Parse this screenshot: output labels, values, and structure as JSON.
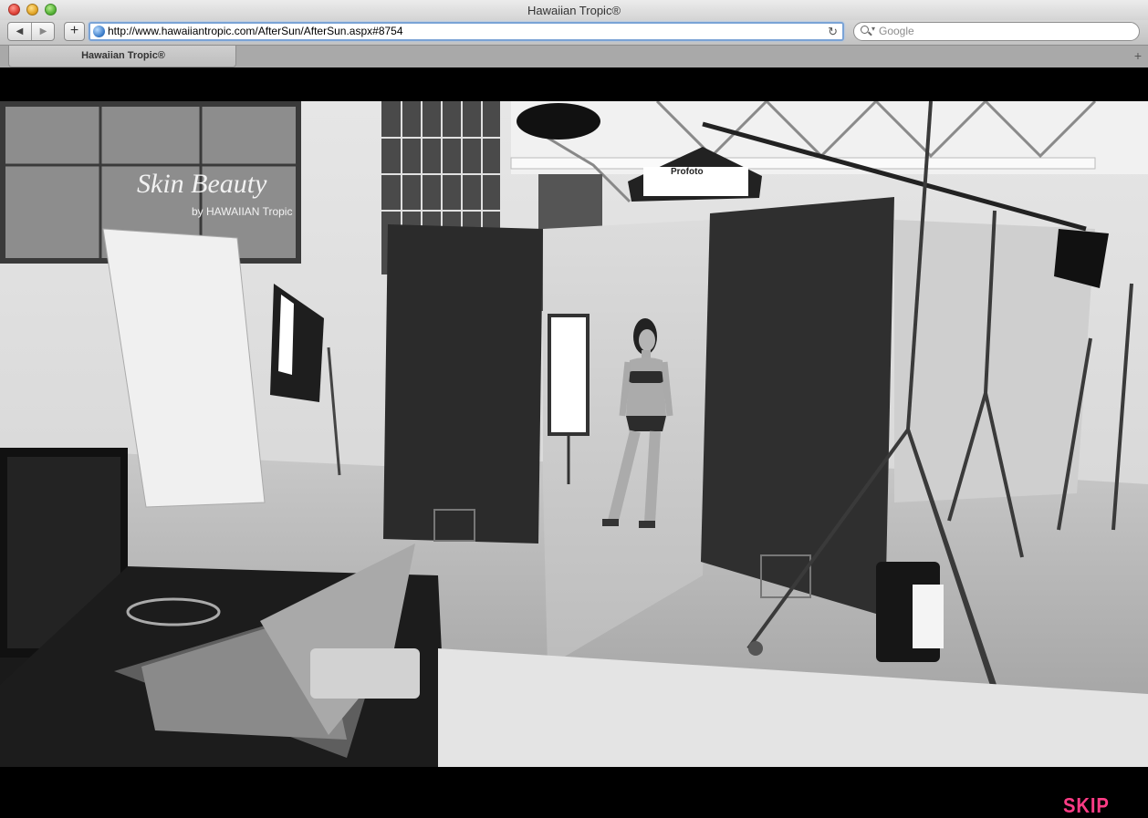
{
  "window": {
    "title": "Hawaiian Tropic®"
  },
  "toolbar": {
    "url": "http://www.hawaiiantropic.com/AfterSun/AfterSun.aspx#8754",
    "search_placeholder": "Google",
    "back_icon": "back-arrow-icon",
    "forward_icon": "forward-arrow-icon",
    "add_icon": "plus-icon",
    "reload_icon": "reload-icon"
  },
  "tabs": [
    {
      "label": "Hawaiian Tropic®"
    }
  ],
  "page": {
    "background": "#000000",
    "banner_text": "Skin Beauty",
    "banner_sub": "by HAWAIIAN Tropic",
    "softbox_brand": "Profoto",
    "skip_label": "SKIP",
    "skip_color": "#ff3c86"
  }
}
